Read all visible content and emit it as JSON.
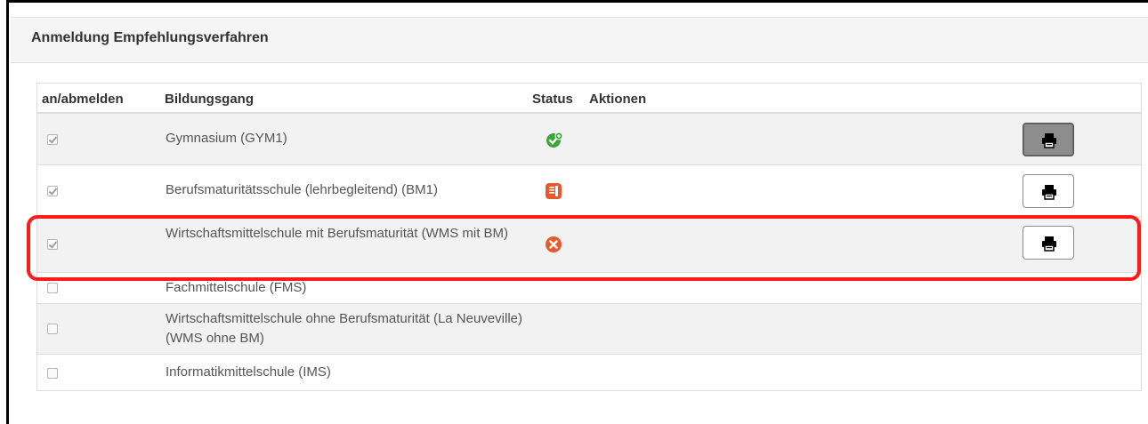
{
  "panel": {
    "title": "Anmeldung Empfehlungsverfahren"
  },
  "table": {
    "headers": {
      "register": "an/abmelden",
      "course": "Bildungsgang",
      "status": "Status",
      "actions": "Aktionen"
    },
    "rows": [
      {
        "checked": true,
        "course": "Gymnasium (GYM1)",
        "status": "confirmed",
        "status_icon": "check-plus-icon",
        "has_print": true,
        "print_active": true
      },
      {
        "checked": true,
        "course": "Berufsmaturitätsschule (lehrbegleitend) (BM1)",
        "status": "pending",
        "status_icon": "document-icon",
        "has_print": true,
        "print_active": false
      },
      {
        "checked": true,
        "course": "Wirtschaftsmittelschule mit Berufsmaturität (WMS mit BM)",
        "status": "rejected",
        "status_icon": "x-circle-icon",
        "has_print": true,
        "print_active": false
      },
      {
        "checked": false,
        "course": "Fachmittelschule (FMS)",
        "has_print": false
      },
      {
        "checked": false,
        "course": "Wirtschaftsmittelschule ohne Berufsmaturität (La Neuveville) (WMS ohne BM)",
        "has_print": false
      },
      {
        "checked": false,
        "course": "Informatikmittelschule (IMS)",
        "has_print": false
      }
    ]
  },
  "colors": {
    "status_green": "#3aa63a",
    "status_orange": "#e8582a",
    "highlight_red": "#ff1a1a"
  }
}
